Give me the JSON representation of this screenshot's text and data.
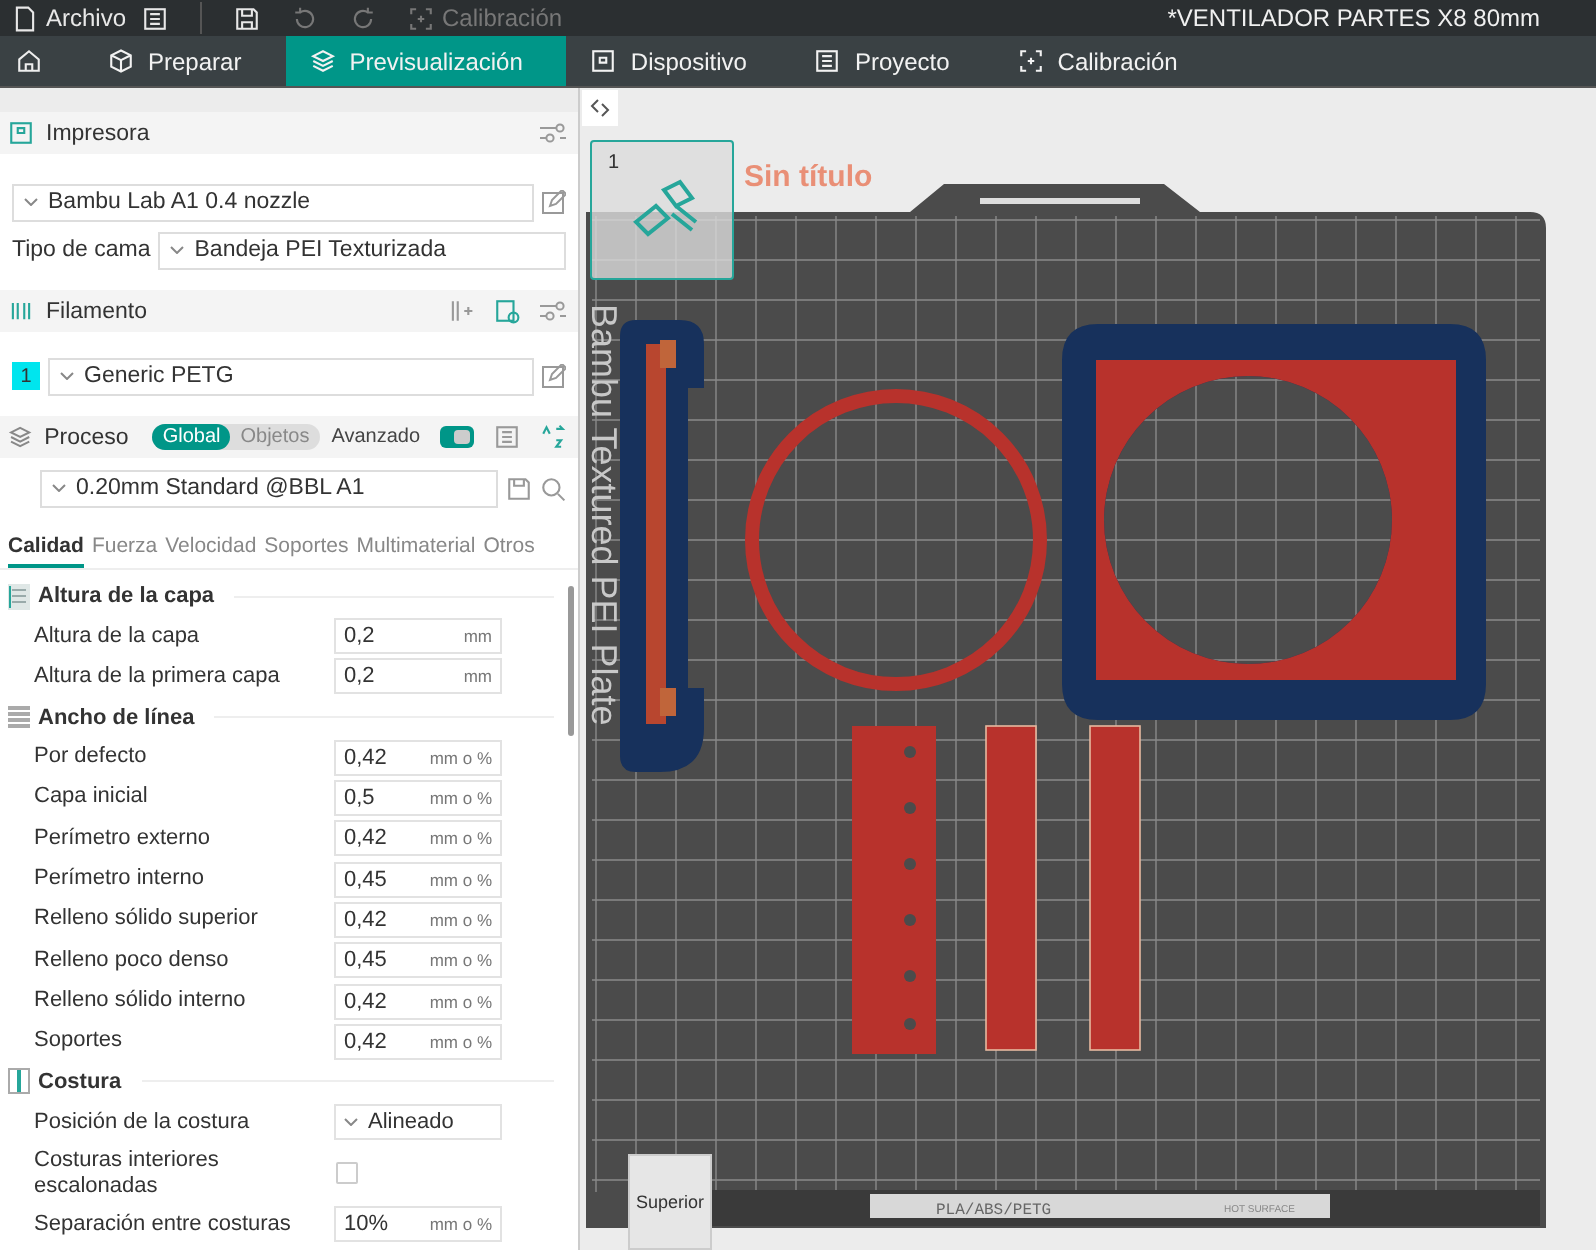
{
  "menu_bar": {
    "file_menu": "Archivo",
    "tools": [
      {
        "kind": "save",
        "disabled": false
      },
      {
        "kind": "undo",
        "disabled": true
      },
      {
        "kind": "redo",
        "disabled": true
      }
    ],
    "calibration": {
      "label": "Calibración",
      "disabled": true
    },
    "project_title": "*VENTILADOR PARTES X8 80mm"
  },
  "tabs": [
    {
      "kind": "prepare",
      "label": "Preparar",
      "selected": false
    },
    {
      "kind": "preview",
      "label": "Previsualización",
      "selected": true
    },
    {
      "kind": "device",
      "label": "Dispositivo",
      "selected": false
    },
    {
      "kind": "project",
      "label": "Proyecto",
      "selected": false
    },
    {
      "kind": "calibration",
      "label": "Calibración",
      "selected": false
    }
  ],
  "printer": {
    "title": "Impresora",
    "preset": "Bambu Lab A1 0.4 nozzle",
    "bed_label": "Tipo de cama",
    "bed_type": "Bandeja PEI Texturizada"
  },
  "filament": {
    "title": "Filamento",
    "items": [
      {
        "index": "1",
        "color": "#00e5ee",
        "name": "Generic PETG"
      }
    ]
  },
  "process": {
    "title": "Proceso",
    "scope": [
      {
        "label": "Global",
        "selected": true
      },
      {
        "label": "Objetos",
        "selected": false
      }
    ],
    "advanced_label": "Avanzado",
    "advanced_on": true,
    "preset": "0.20mm Standard @BBL A1",
    "tabs": [
      {
        "label": "Calidad",
        "selected": true
      },
      {
        "label": "Fuerza",
        "selected": false
      },
      {
        "label": "Velocidad",
        "selected": false
      },
      {
        "label": "Soportes",
        "selected": false
      },
      {
        "label": "Multimaterial",
        "selected": false
      },
      {
        "label": "Otros",
        "selected": false
      }
    ],
    "groups": [
      {
        "kind": "layer",
        "title": "Altura de la capa",
        "rows": [
          {
            "kind": "input",
            "label": "Altura de la capa",
            "value": "0,2",
            "unit": "mm"
          },
          {
            "kind": "input",
            "label": "Altura de la primera capa",
            "value": "0,2",
            "unit": "mm"
          }
        ]
      },
      {
        "kind": "line",
        "title": "Ancho de línea",
        "rows": [
          {
            "kind": "input",
            "label": "Por defecto",
            "value": "0,42",
            "unit": "mm o %"
          },
          {
            "kind": "input",
            "label": "Capa inicial",
            "value": "0,5",
            "unit": "mm o %"
          },
          {
            "kind": "input",
            "label": "Perímetro externo",
            "value": "0,42",
            "unit": "mm o %"
          },
          {
            "kind": "input",
            "label": "Perímetro interno",
            "value": "0,45",
            "unit": "mm o %"
          },
          {
            "kind": "input",
            "label": "Relleno sólido superior",
            "value": "0,42",
            "unit": "mm o %"
          },
          {
            "kind": "input",
            "label": "Relleno poco denso",
            "value": "0,45",
            "unit": "mm o %"
          },
          {
            "kind": "input",
            "label": "Relleno sólido interno",
            "value": "0,42",
            "unit": "mm o %"
          },
          {
            "kind": "input",
            "label": "Soportes",
            "value": "0,42",
            "unit": "mm o %"
          }
        ]
      },
      {
        "kind": "seam",
        "title": "Costura",
        "rows": [
          {
            "kind": "select",
            "label": "Posición de la costura",
            "value": "Alineado"
          },
          {
            "kind": "checkbox",
            "label": "Costuras interiores escalonadas",
            "checked": false
          },
          {
            "kind": "input",
            "label": "Separación entre costuras",
            "value": "10%",
            "unit": "mm o %"
          }
        ]
      }
    ]
  },
  "viewport": {
    "plate_number": "1",
    "project_overlay": "Sin título",
    "plate_label": "Bambu Textured PEI Plate",
    "plate_material": "PLA/ABS/PETG",
    "plate_warning": "HOT SURFACE",
    "view_cube": "Superior"
  }
}
